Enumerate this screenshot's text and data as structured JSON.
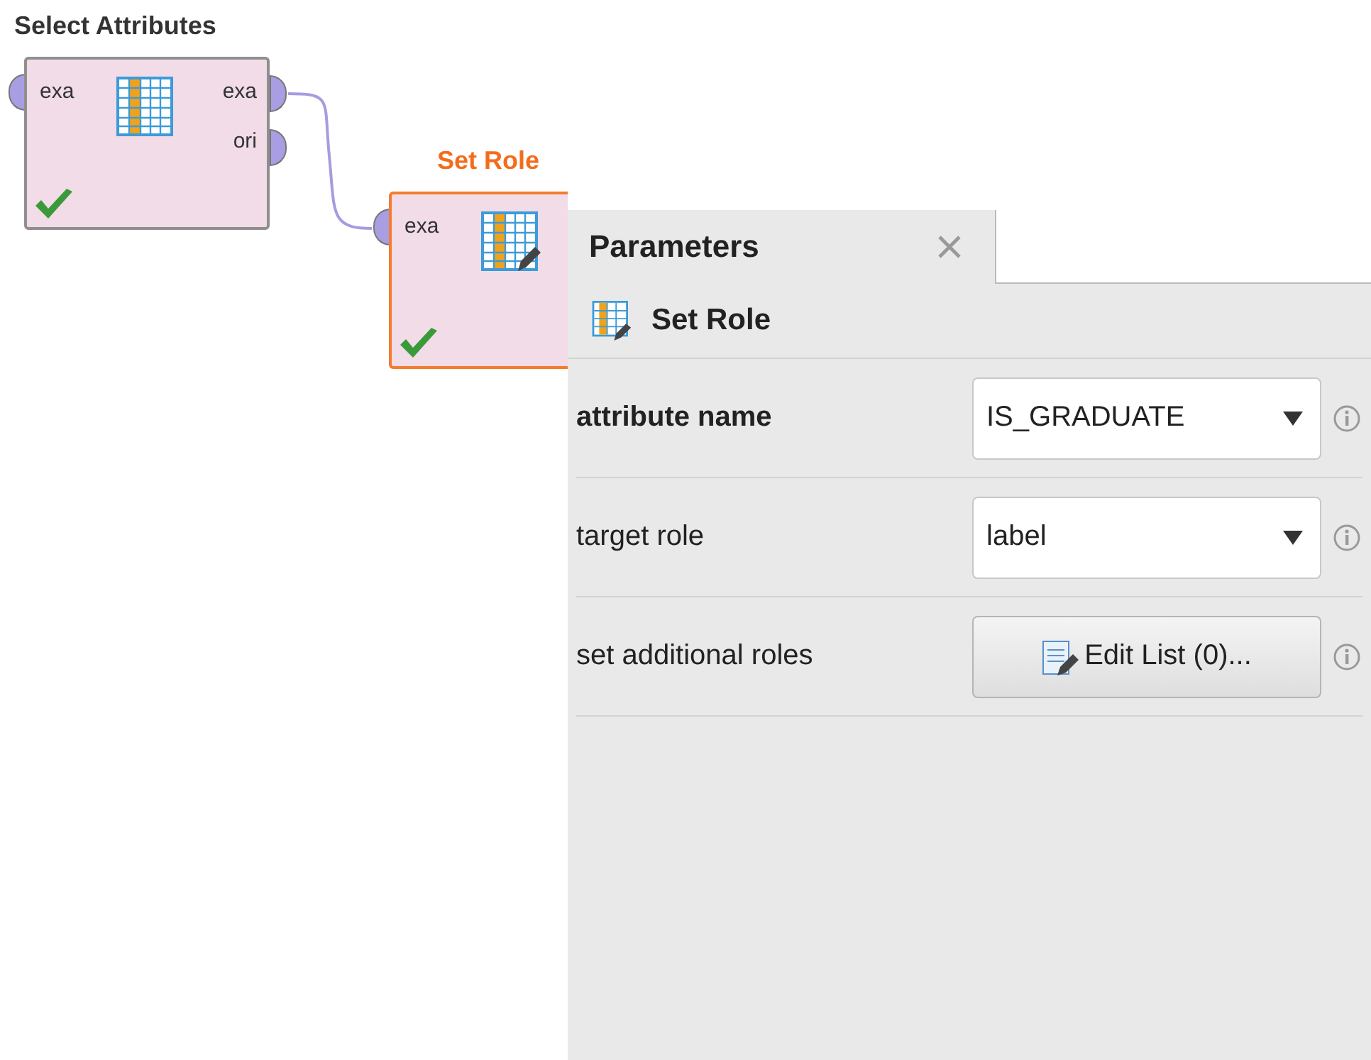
{
  "canvas": {
    "operators": [
      {
        "title": "Select Attributes",
        "selected": false,
        "done": true,
        "inputs": [
          "exa"
        ],
        "outputs": [
          "exa",
          "ori"
        ]
      },
      {
        "title": "Set Role",
        "selected": true,
        "done": true,
        "inputs": [
          "exa"
        ]
      }
    ]
  },
  "parameters_panel": {
    "tab": {
      "label": "Parameters",
      "selected": true
    },
    "operator": "Set Role",
    "parameters": [
      {
        "kind": "dropdown",
        "label": "attribute name",
        "required": true,
        "value": "IS_GRADUATE"
      },
      {
        "kind": "dropdown",
        "label": "target role",
        "required": false,
        "value": "label"
      },
      {
        "kind": "button",
        "label": "set additional roles",
        "required": false,
        "value": "Edit List (0)..."
      }
    ]
  }
}
